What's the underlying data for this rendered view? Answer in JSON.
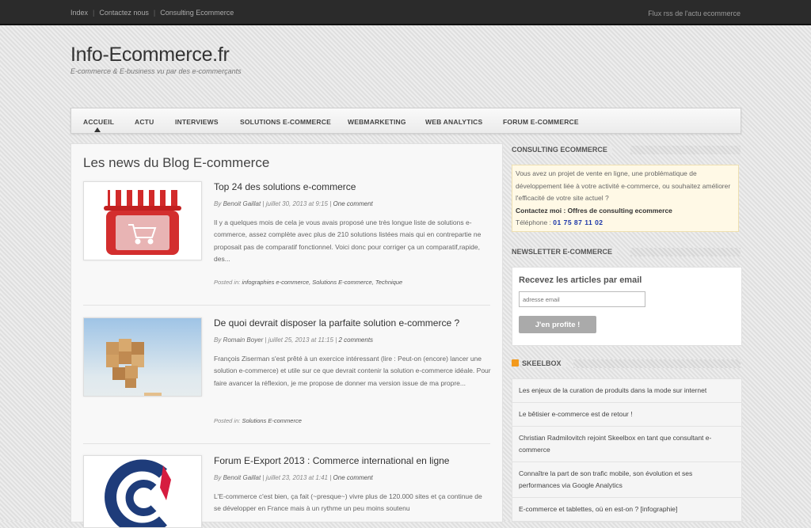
{
  "topbar": {
    "links": [
      "Index",
      "Contactez nous",
      "Consulting Ecommerce"
    ],
    "rss": "Flux rss de l'actu ecommerce"
  },
  "site": {
    "title": "Info-Ecommerce.fr",
    "tagline": "E-commerce & E-business vu par des e-commerçants"
  },
  "nav": {
    "items": [
      "ACCUEIL",
      "ACTU",
      "INTERVIEWS",
      "SOLUTIONS E-COMMERCE",
      "WEBMARKETING",
      "WEB ANALYTICS",
      "FORUM E-COMMERCE"
    ],
    "active": "ACCUEIL"
  },
  "main": {
    "heading": "Les news du Blog E-commerce",
    "posts": [
      {
        "title": "Top 24 des solutions e-commerce",
        "by": "By",
        "author": "Benoit Gaillat",
        "date": "| juillet 30, 2013 at 9:15 |",
        "comments": "One comment",
        "excerpt": "Il y a quelques mois de cela je vous avais proposé une très longue liste de solutions e-commerce, assez complète avec plus de 210 solutions listées mais qui en contrepartie ne proposait pas de comparatif fonctionnel. Voici donc pour corriger ça un comparatif,rapide, des...",
        "posted_in": "Posted in:",
        "categories": "infographies e-commerce, Solutions E-commerce, Technique",
        "thumb_icon": "shop-cart-icon"
      },
      {
        "title": "De quoi devrait disposer la parfaite solution e-commerce ?",
        "by": "By",
        "author": "Romain Boyer",
        "date": "| juillet 25, 2013 at 11:15 |",
        "comments": "2 comments",
        "excerpt": "François Ziserman s'est prêté à un exercice intéressant (lire : Peut-on (encore) lancer une solution e-commerce) et utile sur ce que devrait contenir la solution e-commerce idéale. Pour faire avancer la réflexion, je me propose de donner ma version issue de ma propre...",
        "posted_in": "Posted in:",
        "categories": "Solutions E-commerce",
        "thumb_icon": "wooden-cubes-image"
      },
      {
        "title": "Forum E-Export 2013 : Commerce international en ligne",
        "by": "By",
        "author": "Benoit Gaillat",
        "date": "| juillet 23, 2013 at 1:41 |",
        "comments": "One comment",
        "excerpt": "L'E-commerce c'est bien, ça fait (~presque~) vivre plus de 120.000 sites et ça continue de se développer en France mais à un rythme un peu moins soutenu",
        "thumb_icon": "cci-logo"
      }
    ]
  },
  "sidebar": {
    "consulting": {
      "title": "CONSULTING ECOMMERCE",
      "text": "Vous avez un projet de vente en ligne, une problématique de développement liée à votre activité e-commerce, ou souhaitez améliorer l'efficacité de votre site actuel ?",
      "contact": "Contactez moi : Offres de consulting ecommerce",
      "phone_label": "Téléphone :",
      "phone": "01 75 87 11 02"
    },
    "newsletter": {
      "title": "NEWSLETTER E-COMMERCE",
      "heading": "Recevez les articles par email",
      "placeholder": "adresse email",
      "button": "J'en profite !"
    },
    "skeelbox": {
      "title": "SKEELBOX",
      "items": [
        "Les enjeux de la curation de produits dans la mode sur internet",
        "Le bêtisier e-commerce est de retour !",
        "Christian Radmilovitch rejoint Skeelbox en tant que consultant e-commerce",
        "Connaître la part de son trafic mobile, son évolution et ses performances via Google Analytics",
        "E-commerce et tablettes, où en est-on ? [infographie]"
      ]
    }
  }
}
